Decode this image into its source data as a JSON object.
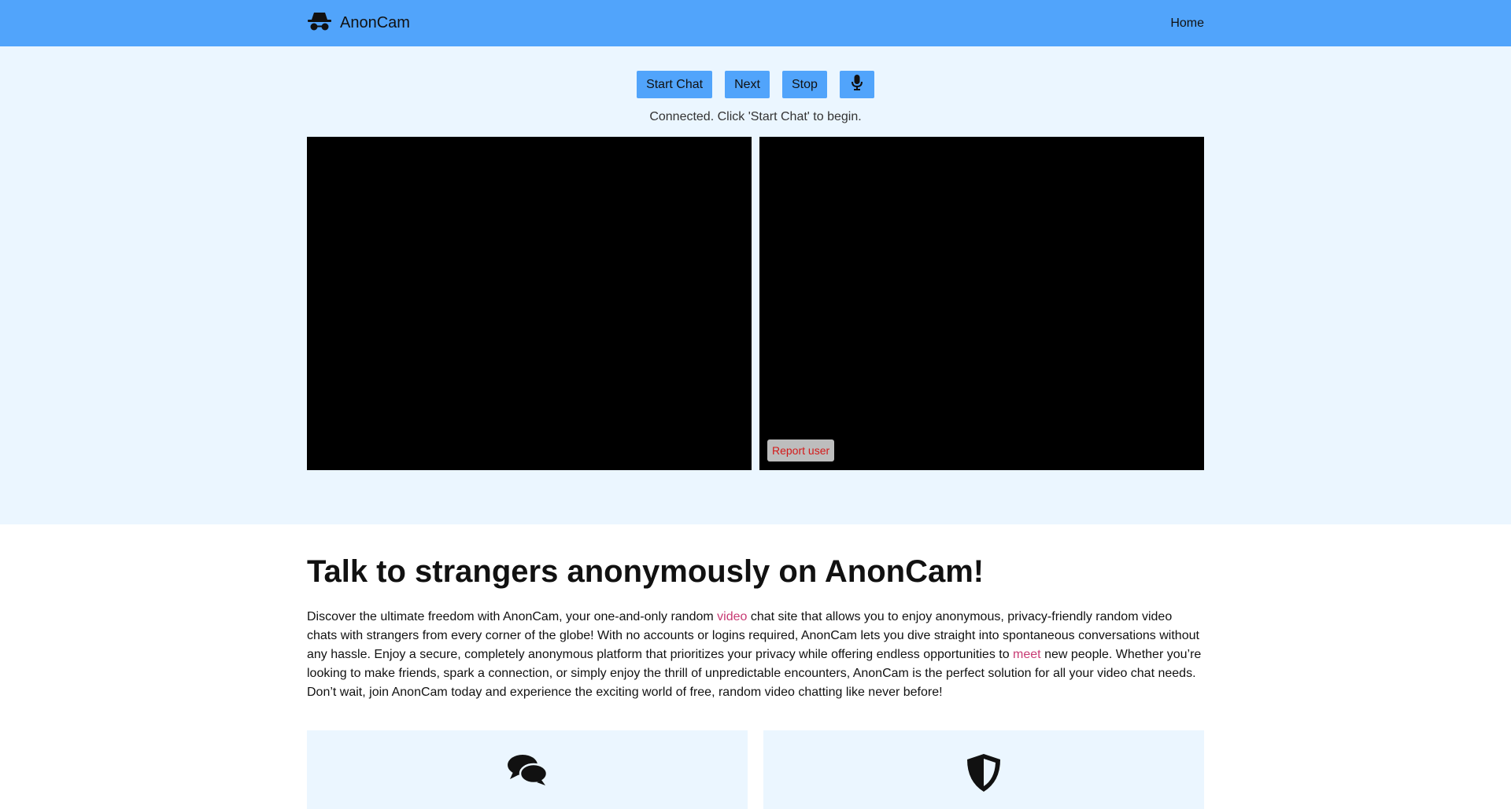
{
  "nav": {
    "brand_icon": "incognito-icon",
    "brand": "AnonCam",
    "home_link": "Home"
  },
  "controls": {
    "start_label": "Start Chat",
    "next_label": "Next",
    "stop_label": "Stop",
    "mic_icon": "microphone-icon"
  },
  "status": "Connected. Click 'Start Chat' to begin.",
  "video": {
    "report_label": "Report user"
  },
  "about": {
    "heading": "Talk to strangers anonymously on AnonCam!",
    "p_part1": "Discover the ultimate freedom with AnonCam, your one-and-only random ",
    "link_video": "video",
    "p_part2": " chat site that allows you to enjoy anonymous, privacy-friendly random video chats with strangers from every corner of the globe! With no accounts or logins required, AnonCam lets you dive straight into spontaneous conversations without any hassle. Enjoy a secure, completely anonymous platform that prioritizes your privacy while offering endless opportunities to ",
    "link_meet": "meet",
    "p_part3": " new people. Whether you’re looking to make friends, spark a connection, or simply enjoy the thrill of unpredictable encounters, AnonCam is the perfect solution for all your video chat needs. Don’t wait, join AnonCam today and experience the exciting world of free, random video chatting like never before!"
  },
  "features": [
    {
      "icon": "chat-bubbles-icon"
    },
    {
      "icon": "shield-icon"
    }
  ],
  "colors": {
    "navbar": "#51a4fb",
    "hero_bg": "#ebf6ff",
    "link": "#c83a73",
    "report_text": "#d31919"
  }
}
